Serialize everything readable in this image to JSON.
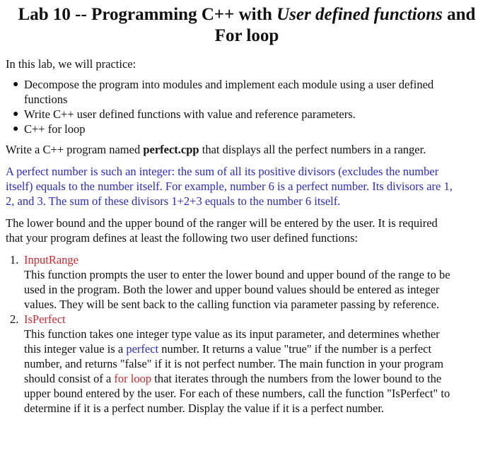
{
  "title": {
    "part1": "Lab 10 -- Programming C++ with ",
    "italic": "User defined functions",
    "part2": " and",
    "line2": "For loop"
  },
  "intro": "In this lab, we will practice:",
  "practice_items": [
    {
      "line1": "Decompose the program into modules and implement each module using a user defined",
      "line2": "functions"
    },
    {
      "line1": "Write C++ user defined functions with value and reference parameters."
    },
    {
      "line1": "C++ for loop"
    }
  ],
  "task": {
    "pre": "Write a C++ program named ",
    "filename": "perfect.cpp",
    "post": " that displays all the perfect numbers in a ranger."
  },
  "definition": [
    "A perfect number is such an integer: the sum of all its positive divisors (excludes the number",
    "itself) equals to the number itself. For example, number 6 is a perfect number. Its divisors are 1,",
    "2, and 3. The sum of these divisors 1+2+3 equals to the number 6 itself."
  ],
  "requirement": [
    "The lower bound and the upper bound of the ranger will be entered by the user. It is required",
    "that your program defines at least the following two user defined functions:"
  ],
  "functions": [
    {
      "number": "1.",
      "name": "InputRange",
      "lines": [
        "This function prompts the user to enter the lower bound and upper bound of the range to be",
        "used in the program. Both the lower and upper bound values should be entered as integer",
        "values. They will be sent back to the calling function via parameter passing by reference."
      ]
    },
    {
      "number": "2.",
      "name": "IsPerfect",
      "line1": "This function takes one integer type value as its input parameter, and determines whether",
      "line2_pre": "this integer value is a ",
      "line2_blue": "perfect",
      "line2_post": " number. It returns a value \"true\" if the number is a perfect",
      "line3": "number, and returns \"false\" if it is not perfect number. The main function in your program",
      "line4_pre": "should consist of a ",
      "line4_red": "for loop",
      "line4_post": " that iterates through the numbers from the lower bound to the",
      "line5": "upper bound entered by the user. For each of these numbers, call the function \"IsPerfect\" to",
      "line6": "determine if it is a perfect number. Display the value if it is a perfect number."
    }
  ],
  "colors": {
    "definition_text": "#2a2ad0",
    "function_name": "#d0262c"
  }
}
